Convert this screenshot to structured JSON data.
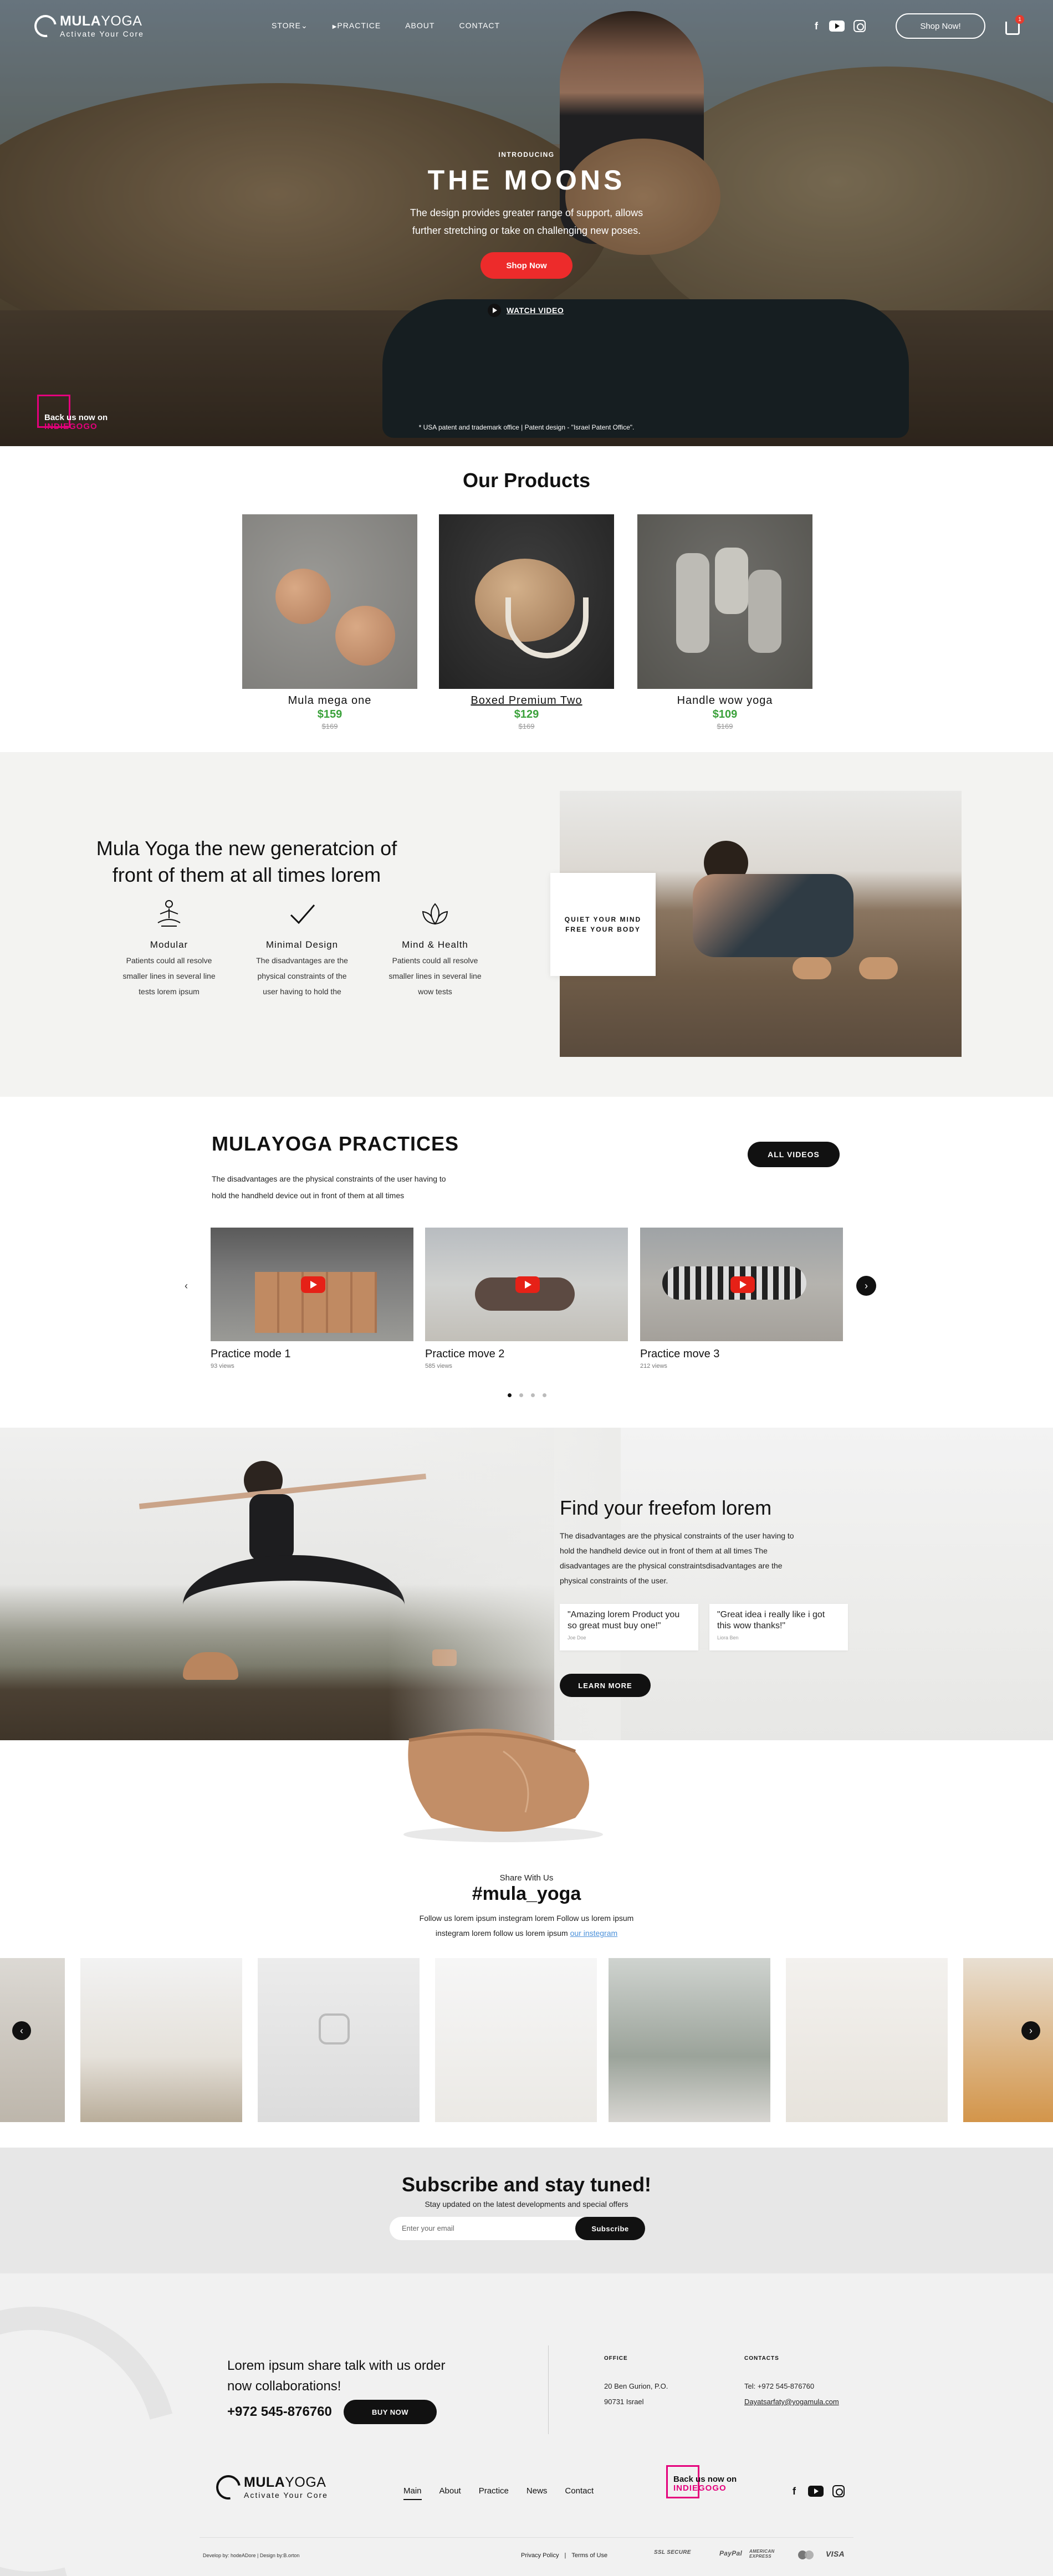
{
  "brand": {
    "name_bold": "MULA",
    "name_light": "YOGA",
    "tagline": "Activate Your Core",
    "accent": "#ed2b2b",
    "price_green": "#3aa13a",
    "indiegogo_pink": "#e4007c"
  },
  "nav": {
    "items": [
      {
        "label": "STORE",
        "icon": "chevron-down-icon"
      },
      {
        "label": "PRACTICE",
        "icon": "video-icon"
      },
      {
        "label": "ABOUT"
      },
      {
        "label": "CONTACT"
      }
    ],
    "shop_now": "Shop Now!",
    "cart_count": "1"
  },
  "hero": {
    "intro": "INTRODUCING",
    "title": "THE MOONS",
    "subtitle_1": "The design provides greater range of support, allows",
    "subtitle_2": "further stretching or take on challenging new poses.",
    "cta": "Shop Now",
    "watch": "WATCH VIDEO",
    "backus_1": "Back us now on",
    "backus_2": "INDIEGOGO",
    "patent": "* USA patent and trademark office | Patent design - \"Israel Patent Office\"."
  },
  "products": {
    "title": "Our Products",
    "items": [
      {
        "name": "Mula mega one",
        "price": "$159",
        "old_price": "$169"
      },
      {
        "name": "Boxed Premium Two",
        "price": "$129",
        "old_price": "$169"
      },
      {
        "name": "Handle wow yoga",
        "price": "$109",
        "old_price": "$169"
      }
    ]
  },
  "about": {
    "title": "Mula Yoga the new generatcion of front of them at all times lorem",
    "overlay_1": "QUIET YOUR MIND",
    "overlay_2": "FREE YOUR BODY",
    "features": [
      {
        "title": "Modular",
        "text_1": "Patients could all resolve",
        "text_2": "smaller lines in several line",
        "text_3": "tests lorem ipsum"
      },
      {
        "title": "Minimal Design",
        "text_1": "The disadvantages are the",
        "text_2": "physical constraints of the",
        "text_3": "user having to hold the"
      },
      {
        "title": "Mind & Health",
        "text_1": "Patients could all resolve",
        "text_2": "smaller lines in several line",
        "text_3": "wow tests"
      }
    ]
  },
  "practices": {
    "title_bold": "MULA",
    "title_light": "YOGA",
    "title_rest": " PRACTICES",
    "desc_1": "The disadvantages are the physical constraints of the user having to",
    "desc_2": "hold the handheld device out in front of them at all times",
    "all_videos": "ALL VIDEOS",
    "videos": [
      {
        "title": "Practice mode 1",
        "views": "93 views"
      },
      {
        "title": "Practice move 2",
        "views": "585 views"
      },
      {
        "title": "Practice move 3",
        "views": "212 views"
      }
    ]
  },
  "freedom": {
    "title": "Find your freefom lorem",
    "desc_1": "The disadvantages are the physical constraints of the user having to",
    "desc_2": "hold the handheld device out in front of them at all times The",
    "desc_3": "disadvantages are the physical constraintsdisadvantages are the",
    "desc_4": "physical constraints of the user.",
    "quotes": [
      {
        "text": "\"Amazing lorem  Product you so great must buy one!\"",
        "author": "Joe Doe"
      },
      {
        "text": "\"Great idea i really like i got this wow thanks!\"",
        "author": "Liora Ben"
      }
    ],
    "cta": "LEARN MORE"
  },
  "share": {
    "small": "Share With Us",
    "tag": "#mula_yoga",
    "desc_1": "Follow us lorem ipsum instegram lorem Follow us lorem ipsum",
    "desc_2": "instegram lorem follow us lorem ipsum",
    "link": "our instegram"
  },
  "subscribe": {
    "title": "Subscribe and stay tuned!",
    "desc": "Stay updated on the latest developments and special offers",
    "placeholder": "Enter your email",
    "button": "Subscribe"
  },
  "footer": {
    "lead": "Lorem ipsum share talk with us order now collaborations!",
    "phone": "+972 545-876760",
    "buy": "BUY NOW",
    "office_head": "OFFICE",
    "office_1": "20 Ben Gurion, P.O.",
    "office_2": "90731 Israel",
    "contacts_head": "CONTACTS",
    "tel": "Tel: +972 545-876760",
    "email": "Dayatsarfaty@yogamula.com",
    "nav": [
      "Main",
      "About",
      "Practice",
      "News",
      "Contact"
    ],
    "credit": "Develop by: hodeADore | Design by:B.orton",
    "privacy": "Privacy Policy",
    "terms": "Terms of Use",
    "ssl": "SSL SECURE",
    "paypal": "PayPal",
    "amex": "AMERICAN EXPRESS",
    "visa": "VISA"
  }
}
